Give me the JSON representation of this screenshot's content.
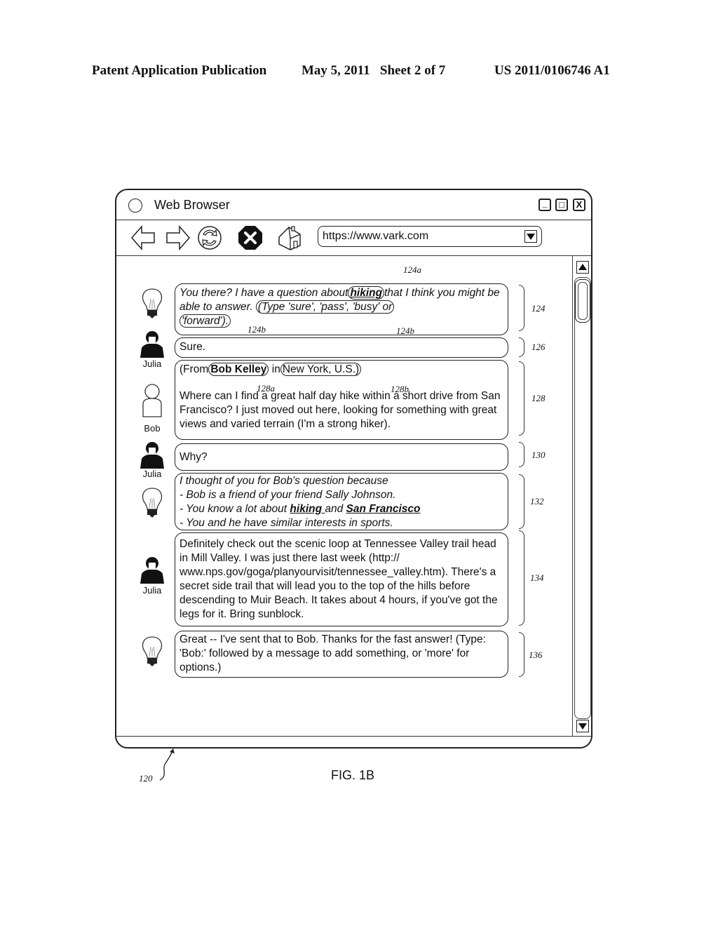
{
  "header": {
    "left": "Patent Application Publication",
    "date_sheet": "May 5, 2011   Sheet 2 of 7",
    "number": "US 2011/0106746 A1"
  },
  "window": {
    "title": "Web Browser",
    "buttons": {
      "minimize": "_",
      "maximize": "□",
      "close": "X"
    },
    "toolbar": {
      "icons": [
        "back-arrow-icon",
        "forward-arrow-icon",
        "refresh-icon",
        "stop-icon",
        "home-icon"
      ],
      "url": "https://www.vark.com"
    }
  },
  "messages": [
    {
      "id": "124",
      "sender": "",
      "avatar": "lightbulb-icon",
      "text_parts": [
        "You there?  I have a question about",
        "hiking",
        "that I think you might be able to answer.  ",
        "(Type 'sure', 'pass', 'busy' or",
        "'forward')."
      ],
      "refs": [
        "124a",
        "124b",
        "124b"
      ]
    },
    {
      "id": "126",
      "sender": "Julia",
      "avatar": "person-dark-icon",
      "text": "Sure."
    },
    {
      "id": "128",
      "sender": "Bob",
      "avatar": "person-light-icon",
      "from_prefix": "(From",
      "from_name": "Bob Kelley",
      "from_in": " in",
      "from_location": "New York, U.S.)",
      "text": "Where can I find a great half day hike within a short drive from San Francisco?  I just moved out here, looking for something with great views and varied terrain (I'm a strong hiker).",
      "refs": [
        "128a",
        "128b"
      ]
    },
    {
      "id": "130",
      "sender": "Julia",
      "avatar": "person-dark-icon",
      "text": "Why?"
    },
    {
      "id": "132",
      "sender": "",
      "avatar": "lightbulb-icon",
      "lines": [
        "I thought of you for Bob's question because",
        "- Bob is a friend of your friend Sally Johnson.",
        "- You know a lot about ",
        "hiking ",
        "and ",
        "San Francisco",
        "- You and he have similar interests in sports."
      ]
    },
    {
      "id": "134",
      "sender": "Julia",
      "avatar": "person-dark-icon",
      "text": "Definitely check out the scenic loop at Tennessee Valley trail head in Mill Valley.  I was just there last week (http:// www.nps.gov/goga/planyourvisit/tennessee_valley.htm). There's a secret side trail that will lead you to the top of the hills before descending to Muir Beach.  It takes about 4 hours, if you've got the legs for it.  Bring sunblock."
    },
    {
      "id": "136",
      "sender": "",
      "avatar": "lightbulb-icon",
      "text": "Great -- I've sent that to Bob.  Thanks for the fast answer! (Type: 'Bob:' followed by a message to add something, or 'more' for options.)"
    }
  ],
  "labels": {
    "window_ref": "120",
    "figure": "FIG. 1B"
  }
}
